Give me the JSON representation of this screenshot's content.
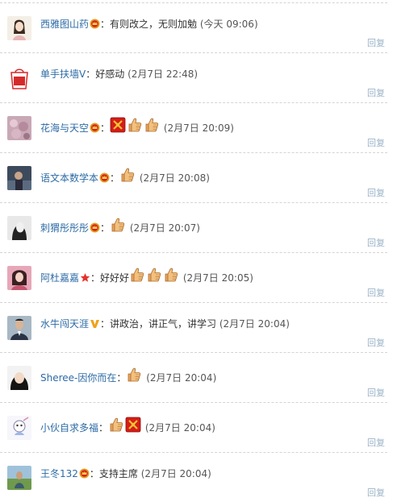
{
  "comments": [
    {
      "user": "西雅图山药",
      "badge": "crown-red",
      "text": "：有则改之，无则加勉",
      "emojis": [],
      "time": "(今天 09:06)",
      "reply": "回复",
      "avatar": "avatar-girl-drawing"
    },
    {
      "user": "单手扶墙V",
      "badge": "none",
      "text": "：好感动",
      "emojis": [],
      "time": "(2月7日 22:48)",
      "reply": "回复",
      "avatar": "avatar-red-logo"
    },
    {
      "user": "花海与天空",
      "badge": "crown-red",
      "text": "：",
      "emojis": [
        "red-square-emoji",
        "thumbs-up-emoji",
        "thumbs-up-emoji"
      ],
      "time": "(2月7日 20:09)",
      "reply": "回复",
      "avatar": "avatar-flowers"
    },
    {
      "user": "语文本数学本",
      "badge": "crown-red",
      "text": "：",
      "emojis": [
        "thumbs-up-emoji"
      ],
      "time": "(2月7日 20:08)",
      "reply": "回复",
      "avatar": "avatar-dark-photo"
    },
    {
      "user": "刺猬彤彤彤",
      "badge": "crown-red",
      "text": "：",
      "emojis": [
        "thumbs-up-emoji"
      ],
      "time": "(2月7日 20:07)",
      "reply": "回复",
      "avatar": "avatar-bw-portrait"
    },
    {
      "user": "阿杜嘉嘉",
      "badge": "star-red",
      "text": "：好好好",
      "emojis": [
        "thumbs-up-emoji",
        "thumbs-up-emoji",
        "thumbs-up-emoji"
      ],
      "time": "(2月7日 20:05)",
      "reply": "回复",
      "avatar": "avatar-pink-portrait"
    },
    {
      "user": "水牛闯天涯",
      "badge": "v-yellow",
      "text": "：讲政治，讲正气，讲学习",
      "emojis": [],
      "time": "(2月7日 20:04)",
      "reply": "回复",
      "avatar": "avatar-man-suit"
    },
    {
      "user": "Sheree-因你而在",
      "badge": "none",
      "text": "：",
      "emojis": [
        "thumbs-up-emoji"
      ],
      "time": "(2月7日 20:04)",
      "reply": "回复",
      "avatar": "avatar-girl-dark-hair"
    },
    {
      "user": "小伙自求多福",
      "badge": "none",
      "text": "：",
      "emojis": [
        "thumbs-up-emoji",
        "red-square-emoji"
      ],
      "time": "(2月7日 20:04)",
      "reply": "回复",
      "avatar": "avatar-cartoon"
    },
    {
      "user": "王冬132",
      "badge": "crown-red",
      "text": "：支持主席",
      "emojis": [],
      "time": "(2月7日 20:04)",
      "reply": "回复",
      "avatar": "avatar-outdoor"
    }
  ],
  "colors": {
    "username": "#2d6ba5",
    "reply": "#9ab3c7",
    "separator": "#d4d4d4"
  }
}
